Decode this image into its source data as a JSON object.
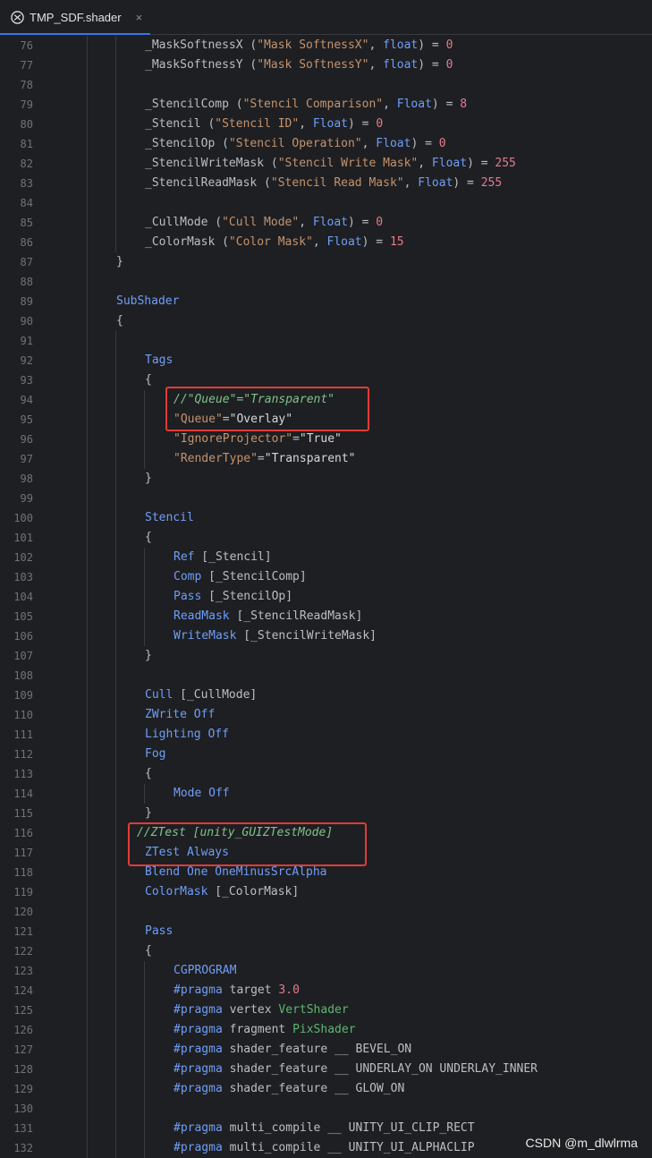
{
  "tab": {
    "title": "TMP_SDF.shader",
    "icon": "unity-icon",
    "close": "×"
  },
  "watermark": "CSDN @m_dlwlrma",
  "lines": [
    {
      "num": "76",
      "indent": 2,
      "seg": [
        [
          "_MaskSoftnessX (",
          ""
        ],
        [
          "\"Mask SoftnessX\"",
          "s"
        ],
        [
          ", ",
          ""
        ],
        [
          "float",
          "k"
        ],
        [
          ") = ",
          ""
        ],
        [
          "0",
          "n"
        ]
      ]
    },
    {
      "num": "77",
      "indent": 2,
      "seg": [
        [
          "_MaskSoftnessY (",
          ""
        ],
        [
          "\"Mask SoftnessY\"",
          "s"
        ],
        [
          ", ",
          ""
        ],
        [
          "float",
          "k"
        ],
        [
          ") = ",
          ""
        ],
        [
          "0",
          "n"
        ]
      ]
    },
    {
      "num": "78",
      "indent": 2,
      "seg": []
    },
    {
      "num": "79",
      "indent": 2,
      "seg": [
        [
          "_StencilComp (",
          ""
        ],
        [
          "\"Stencil Comparison\"",
          "s"
        ],
        [
          ", ",
          ""
        ],
        [
          "Float",
          "k"
        ],
        [
          ") = ",
          ""
        ],
        [
          "8",
          "n"
        ]
      ]
    },
    {
      "num": "80",
      "indent": 2,
      "seg": [
        [
          "_Stencil (",
          ""
        ],
        [
          "\"Stencil ID\"",
          "s"
        ],
        [
          ", ",
          ""
        ],
        [
          "Float",
          "k"
        ],
        [
          ") = ",
          ""
        ],
        [
          "0",
          "n"
        ]
      ]
    },
    {
      "num": "81",
      "indent": 2,
      "seg": [
        [
          "_StencilOp (",
          ""
        ],
        [
          "\"Stencil Operation\"",
          "s"
        ],
        [
          ", ",
          ""
        ],
        [
          "Float",
          "k"
        ],
        [
          ") = ",
          ""
        ],
        [
          "0",
          "n"
        ]
      ]
    },
    {
      "num": "82",
      "indent": 2,
      "seg": [
        [
          "_StencilWriteMask (",
          ""
        ],
        [
          "\"Stencil Write Mask\"",
          "s"
        ],
        [
          ", ",
          ""
        ],
        [
          "Float",
          "k"
        ],
        [
          ") = ",
          ""
        ],
        [
          "255",
          "n"
        ]
      ]
    },
    {
      "num": "83",
      "indent": 2,
      "seg": [
        [
          "_StencilReadMask (",
          ""
        ],
        [
          "\"Stencil Read Mask\"",
          "s"
        ],
        [
          ", ",
          ""
        ],
        [
          "Float",
          "k"
        ],
        [
          ") = ",
          ""
        ],
        [
          "255",
          "n"
        ]
      ]
    },
    {
      "num": "84",
      "indent": 2,
      "seg": []
    },
    {
      "num": "85",
      "indent": 2,
      "seg": [
        [
          "_CullMode (",
          ""
        ],
        [
          "\"Cull Mode\"",
          "s"
        ],
        [
          ", ",
          ""
        ],
        [
          "Float",
          "k"
        ],
        [
          ") = ",
          ""
        ],
        [
          "0",
          "n"
        ]
      ]
    },
    {
      "num": "86",
      "indent": 2,
      "seg": [
        [
          "_ColorMask (",
          ""
        ],
        [
          "\"Color Mask\"",
          "s"
        ],
        [
          ", ",
          ""
        ],
        [
          "Float",
          "k"
        ],
        [
          ") = ",
          ""
        ],
        [
          "15",
          "n"
        ]
      ]
    },
    {
      "num": "87",
      "indent": 1,
      "seg": [
        [
          "}",
          ""
        ]
      ]
    },
    {
      "num": "88",
      "indent": 1,
      "seg": []
    },
    {
      "num": "89",
      "indent": 1,
      "seg": [
        [
          "SubShader",
          "k"
        ]
      ]
    },
    {
      "num": "90",
      "indent": 1,
      "seg": [
        [
          "{",
          ""
        ]
      ]
    },
    {
      "num": "91",
      "indent": 2,
      "seg": []
    },
    {
      "num": "92",
      "indent": 2,
      "seg": [
        [
          "Tags",
          "k"
        ]
      ]
    },
    {
      "num": "93",
      "indent": 2,
      "seg": [
        [
          "{",
          ""
        ]
      ]
    },
    {
      "num": "94",
      "indent": 3,
      "seg": [
        [
          "//\"Queue\"=\"Transparent\"",
          "c"
        ]
      ]
    },
    {
      "num": "95",
      "indent": 3,
      "seg": [
        [
          "\"Queue\"",
          "s"
        ],
        [
          "=",
          ""
        ],
        [
          "\"Overlay\"",
          "q"
        ]
      ]
    },
    {
      "num": "96",
      "indent": 3,
      "seg": [
        [
          "\"IgnoreProjector\"",
          "s"
        ],
        [
          "=",
          ""
        ],
        [
          "\"True\"",
          "q"
        ]
      ]
    },
    {
      "num": "97",
      "indent": 3,
      "seg": [
        [
          "\"RenderType\"",
          "s"
        ],
        [
          "=",
          ""
        ],
        [
          "\"Transparent\"",
          "q"
        ]
      ]
    },
    {
      "num": "98",
      "indent": 2,
      "seg": [
        [
          "}",
          ""
        ]
      ]
    },
    {
      "num": "99",
      "indent": 2,
      "seg": []
    },
    {
      "num": "100",
      "indent": 2,
      "seg": [
        [
          "Stencil",
          "k"
        ]
      ]
    },
    {
      "num": "101",
      "indent": 2,
      "seg": [
        [
          "{",
          ""
        ]
      ]
    },
    {
      "num": "102",
      "indent": 3,
      "seg": [
        [
          "Ref",
          "k"
        ],
        [
          " [_Stencil]",
          ""
        ]
      ]
    },
    {
      "num": "103",
      "indent": 3,
      "seg": [
        [
          "Comp",
          "k"
        ],
        [
          " [_StencilComp]",
          ""
        ]
      ]
    },
    {
      "num": "104",
      "indent": 3,
      "seg": [
        [
          "Pass",
          "k"
        ],
        [
          " [_StencilOp]",
          ""
        ]
      ]
    },
    {
      "num": "105",
      "indent": 3,
      "seg": [
        [
          "ReadMask",
          "k"
        ],
        [
          " [_StencilReadMask]",
          ""
        ]
      ]
    },
    {
      "num": "106",
      "indent": 3,
      "seg": [
        [
          "WriteMask",
          "k"
        ],
        [
          " [_StencilWriteMask]",
          ""
        ]
      ]
    },
    {
      "num": "107",
      "indent": 2,
      "seg": [
        [
          "}",
          ""
        ]
      ]
    },
    {
      "num": "108",
      "indent": 2,
      "seg": []
    },
    {
      "num": "109",
      "indent": 2,
      "seg": [
        [
          "Cull",
          "k"
        ],
        [
          " [_CullMode]",
          ""
        ]
      ]
    },
    {
      "num": "110",
      "indent": 2,
      "seg": [
        [
          "ZWrite Off",
          "k"
        ]
      ]
    },
    {
      "num": "111",
      "indent": 2,
      "seg": [
        [
          "Lighting Off",
          "k"
        ]
      ]
    },
    {
      "num": "112",
      "indent": 2,
      "seg": [
        [
          "Fog",
          "k"
        ]
      ]
    },
    {
      "num": "113",
      "indent": 2,
      "seg": [
        [
          "{",
          ""
        ]
      ]
    },
    {
      "num": "114",
      "indent": 3,
      "seg": [
        [
          "Mode Off",
          "k"
        ]
      ]
    },
    {
      "num": "115",
      "indent": 2,
      "seg": [
        [
          "}",
          ""
        ]
      ]
    },
    {
      "num": "116",
      "indent": 2,
      "shift": -1,
      "seg": [
        [
          "//ZTest [unity_GUIZTestMode]",
          "c"
        ]
      ]
    },
    {
      "num": "117",
      "indent": 2,
      "seg": [
        [
          "ZTest Always",
          "k"
        ]
      ]
    },
    {
      "num": "118",
      "indent": 2,
      "seg": [
        [
          "Blend One OneMinusSrcAlpha",
          "k"
        ]
      ]
    },
    {
      "num": "119",
      "indent": 2,
      "seg": [
        [
          "ColorMask",
          "k"
        ],
        [
          " [_ColorMask]",
          ""
        ]
      ]
    },
    {
      "num": "120",
      "indent": 2,
      "seg": []
    },
    {
      "num": "121",
      "indent": 2,
      "seg": [
        [
          "Pass",
          "k"
        ]
      ]
    },
    {
      "num": "122",
      "indent": 2,
      "seg": [
        [
          "{",
          ""
        ]
      ]
    },
    {
      "num": "123",
      "indent": 3,
      "seg": [
        [
          "CGPROGRAM",
          "k"
        ]
      ]
    },
    {
      "num": "124",
      "indent": 3,
      "seg": [
        [
          "#pragma",
          "k"
        ],
        [
          " target ",
          ""
        ],
        [
          "3.0",
          "n"
        ]
      ]
    },
    {
      "num": "125",
      "indent": 3,
      "seg": [
        [
          "#pragma",
          "k"
        ],
        [
          " vertex ",
          ""
        ],
        [
          "VertShader",
          "g"
        ]
      ]
    },
    {
      "num": "126",
      "indent": 3,
      "seg": [
        [
          "#pragma",
          "k"
        ],
        [
          " fragment ",
          ""
        ],
        [
          "PixShader",
          "g"
        ]
      ]
    },
    {
      "num": "127",
      "indent": 3,
      "seg": [
        [
          "#pragma",
          "k"
        ],
        [
          " shader_feature __ BEVEL_ON",
          ""
        ]
      ]
    },
    {
      "num": "128",
      "indent": 3,
      "seg": [
        [
          "#pragma",
          "k"
        ],
        [
          " shader_feature __ UNDERLAY_ON UNDERLAY_INNER",
          ""
        ]
      ]
    },
    {
      "num": "129",
      "indent": 3,
      "seg": [
        [
          "#pragma",
          "k"
        ],
        [
          " shader_feature __ GLOW_ON",
          ""
        ]
      ]
    },
    {
      "num": "130",
      "indent": 3,
      "seg": []
    },
    {
      "num": "131",
      "indent": 3,
      "seg": [
        [
          "#pragma",
          "k"
        ],
        [
          " multi_compile __ UNITY_UI_CLIP_RECT",
          ""
        ]
      ]
    },
    {
      "num": "132",
      "indent": 3,
      "seg": [
        [
          "#pragma",
          "k"
        ],
        [
          " multi_compile __ UNITY_UI_ALPHACLIP",
          ""
        ]
      ]
    }
  ],
  "highlights": [
    {
      "from": "94",
      "to": "95",
      "note": "queue-highlight"
    },
    {
      "from": "116",
      "to": "117",
      "note": "ztest-highlight"
    }
  ]
}
